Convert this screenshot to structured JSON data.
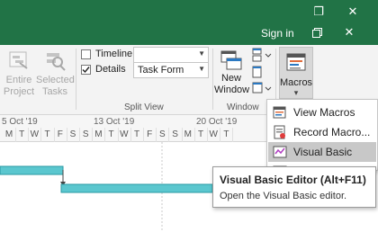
{
  "window": {
    "restore_glyph": "❐",
    "close_glyph": "✕",
    "brand_color": "#217346"
  },
  "tabs": {
    "signin_label": "Sign in"
  },
  "ribbon": {
    "entire_project_line1": "Entire",
    "entire_project_line2": "Project",
    "selected_tasks_line1": "Selected",
    "selected_tasks_line2": "Tasks",
    "timeline_label": "Timeline",
    "details_label": "Details",
    "details_value": "Task Form",
    "split_view_label": "Split View",
    "new_window_line1": "New",
    "new_window_line2": "Window",
    "window_group_label": "Window",
    "macros_label": "Macros",
    "macros_arrow": "▾"
  },
  "timescale": {
    "weeks": [
      "5 Oct '19",
      "13 Oct '19",
      "20 Oct '19"
    ],
    "days": [
      "M",
      "T",
      "W",
      "T",
      "F",
      "S",
      "S",
      "M",
      "T",
      "W",
      "T",
      "F",
      "S",
      "S",
      "M",
      "T",
      "W",
      "T"
    ]
  },
  "menu": {
    "view_macros": "View Macros",
    "record_macro": "Record Macro...",
    "visual_basic": "Visual Basic"
  },
  "tooltip": {
    "title": "Visual Basic Editor (Alt+F11)",
    "description": "Open the Visual Basic editor."
  },
  "colors": {
    "bar": "#5bc7cf",
    "bar_border": "#2a9aa3"
  }
}
